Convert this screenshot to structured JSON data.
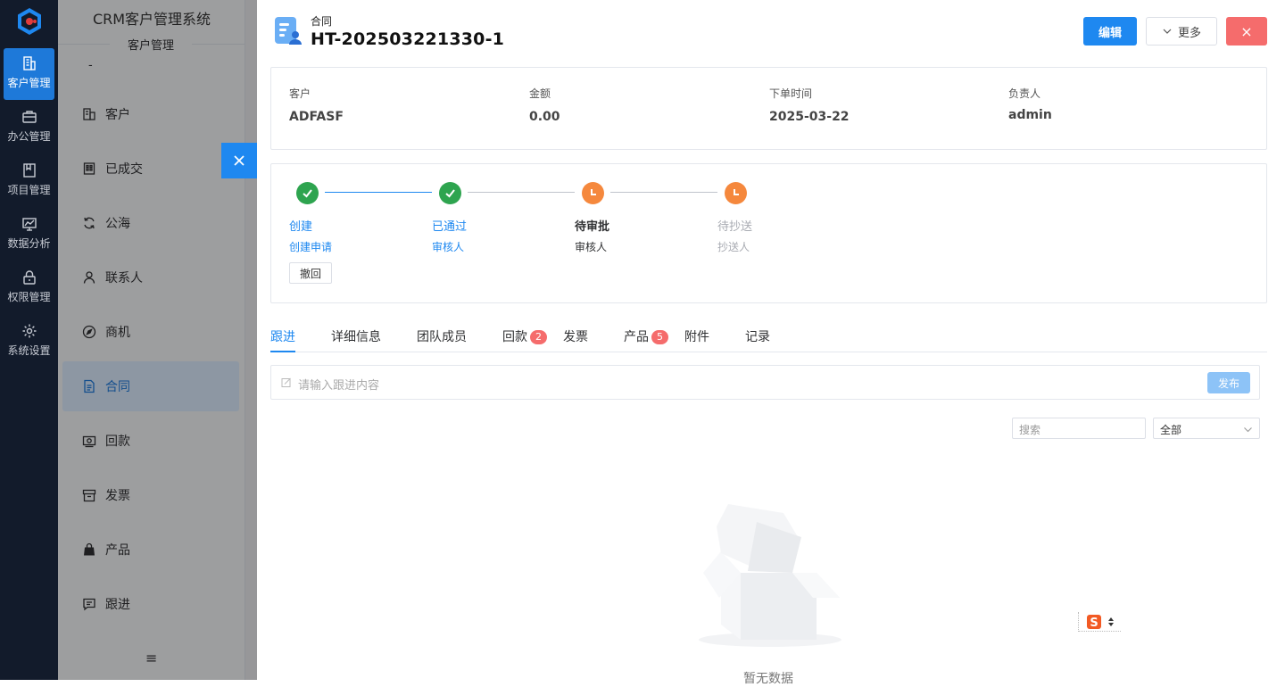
{
  "app": {
    "title": "CRM客户管理系统",
    "section_tag": "客户管理",
    "dash": "-"
  },
  "rail": {
    "items": [
      {
        "label": "客户管理",
        "icon": "building-icon"
      },
      {
        "label": "办公管理",
        "icon": "briefcase-icon"
      },
      {
        "label": "项目管理",
        "icon": "bookmark-icon"
      },
      {
        "label": "数据分析",
        "icon": "chart-icon"
      },
      {
        "label": "权限管理",
        "icon": "lock-icon"
      },
      {
        "label": "系统设置",
        "icon": "gear-icon"
      }
    ]
  },
  "sidebar": {
    "items": [
      {
        "label": "客户",
        "icon": "building-icon"
      },
      {
        "label": "已成交",
        "icon": "office-icon"
      },
      {
        "label": "公海",
        "icon": "refresh-icon"
      },
      {
        "label": "联系人",
        "icon": "user-icon"
      },
      {
        "label": "商机",
        "icon": "compass-icon"
      },
      {
        "label": "合同",
        "icon": "document-icon"
      },
      {
        "label": "回款",
        "icon": "money-icon"
      },
      {
        "label": "发票",
        "icon": "invoice-icon"
      },
      {
        "label": "产品",
        "icon": "bag-icon"
      },
      {
        "label": "跟进",
        "icon": "message-icon"
      }
    ],
    "collapse_glyph": "≡"
  },
  "drawer": {
    "type_label": "合同",
    "number": "HT-202503221330-1",
    "edit_label": "编辑",
    "more_label": "更多",
    "close_glyph": "×"
  },
  "info": {
    "fields": [
      {
        "label": "客户",
        "value": "ADFASF"
      },
      {
        "label": "金额",
        "value": "0.00"
      },
      {
        "label": "下单时间",
        "value": "2025-03-22"
      },
      {
        "label": "负责人",
        "value": "admin"
      }
    ]
  },
  "flow": {
    "steps": [
      {
        "title": "创建",
        "sub": "创建申请",
        "state": "done"
      },
      {
        "title": "已通过",
        "sub": "审核人",
        "state": "done"
      },
      {
        "title": "待审批",
        "sub": "审核人",
        "state": "current"
      },
      {
        "title": "待抄送",
        "sub": "抄送人",
        "state": "pending"
      }
    ],
    "revoke_label": "撤回",
    "colors": {
      "done": "#2ea44f",
      "pending": "#f5883d",
      "active_line": "#1e88f0"
    }
  },
  "tabs": [
    {
      "label": "跟进"
    },
    {
      "label": "详细信息"
    },
    {
      "label": "团队成员"
    },
    {
      "label": "回款",
      "badge": "2"
    },
    {
      "label": "发票"
    },
    {
      "label": "产品",
      "badge": "5"
    },
    {
      "label": "附件"
    },
    {
      "label": "记录"
    }
  ],
  "followup": {
    "placeholder": "请输入跟进内容",
    "post_label": "发布",
    "search_placeholder": "搜索",
    "filter_value": "全部",
    "empty_text": "暂无数据"
  }
}
